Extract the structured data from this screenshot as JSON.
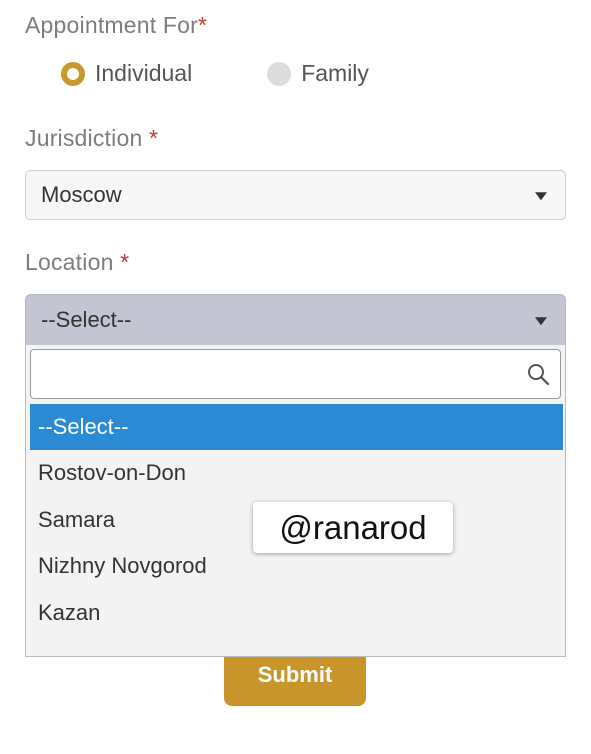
{
  "form": {
    "appointment_label": "Appointment For",
    "appointment_required": "*",
    "radio_individual": "Individual",
    "radio_family": "Family",
    "jurisdiction_label": "Jurisdiction",
    "jurisdiction_required": "*",
    "jurisdiction_value": "Moscow",
    "location_label": "Location",
    "location_required": "*",
    "location_value": "--Select--",
    "submit_label": "Submit"
  },
  "dropdown": {
    "search_value": "",
    "options": [
      "--Select--",
      "Rostov-on-Don",
      "Samara",
      "Nizhny Novgorod",
      "Kazan"
    ],
    "selected_index": 0
  },
  "watermark": "@ranarod",
  "colors": {
    "accent": "#c89a2c",
    "selected_option": "#2a8ad4",
    "required": "#c0392b",
    "submit": "#c8952a"
  }
}
